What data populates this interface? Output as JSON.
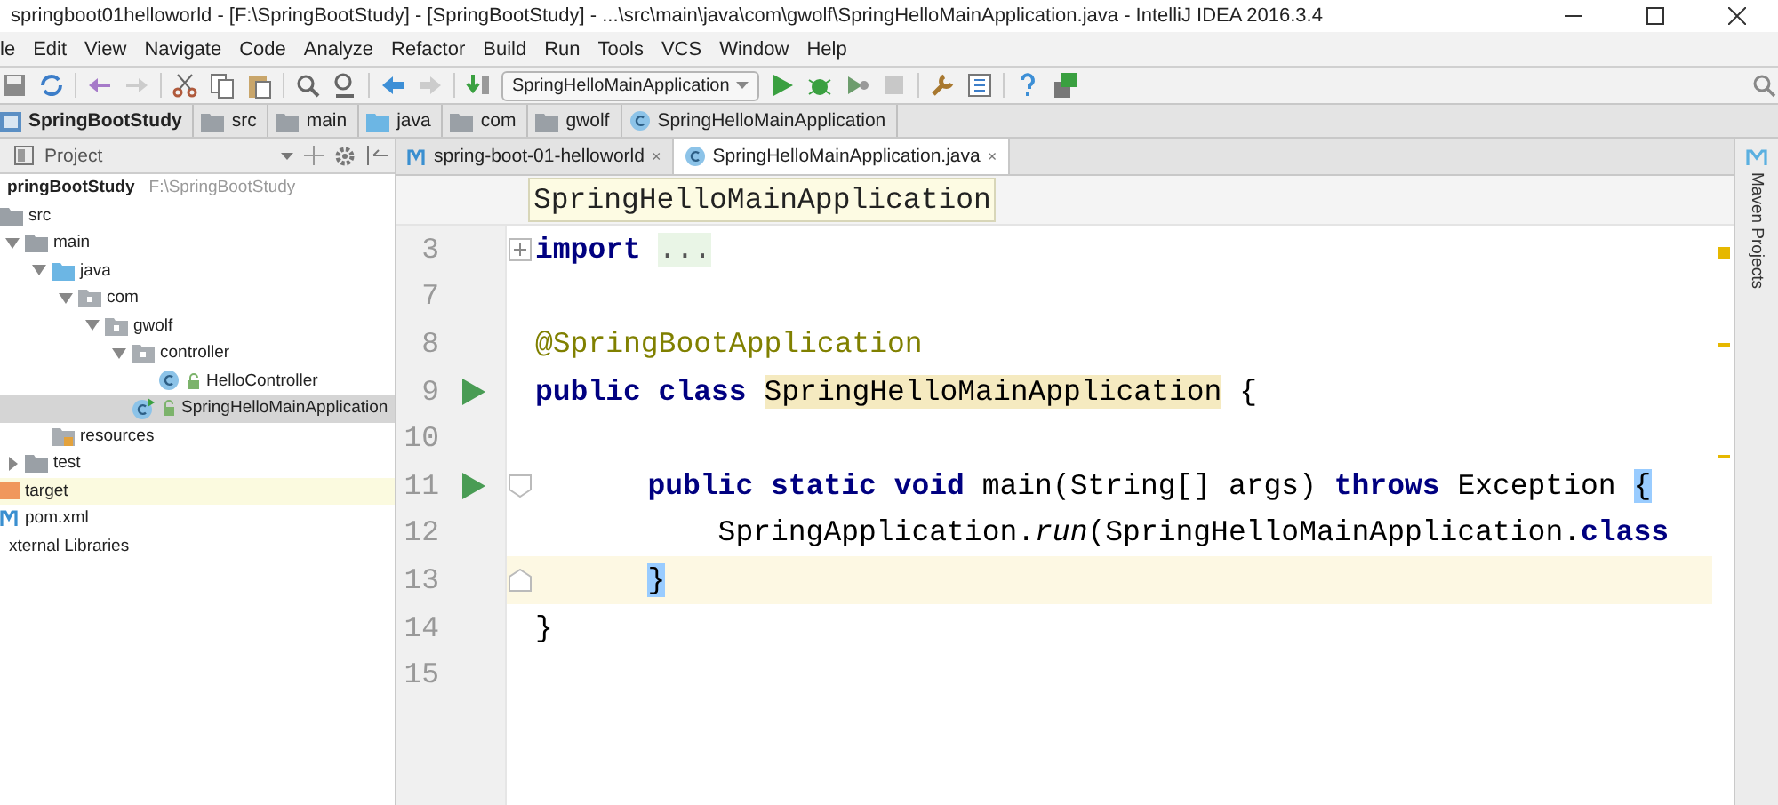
{
  "window": {
    "title": "springboot01helloworld - [F:\\SpringBootStudy] - [SpringBootStudy] - ...\\src\\main\\java\\com\\gwolf\\SpringHelloMainApplication.java - IntelliJ IDEA 2016.3.4"
  },
  "menu": [
    "le",
    "Edit",
    "View",
    "Navigate",
    "Code",
    "Analyze",
    "Refactor",
    "Build",
    "Run",
    "Tools",
    "VCS",
    "Window",
    "Help"
  ],
  "toolbar": {
    "run_config": "SpringHelloMainApplication"
  },
  "breadcrumbs": [
    {
      "label": "SpringBootStudy",
      "kind": "module"
    },
    {
      "label": "src",
      "kind": "folder"
    },
    {
      "label": "main",
      "kind": "folder"
    },
    {
      "label": "java",
      "kind": "source"
    },
    {
      "label": "com",
      "kind": "folder"
    },
    {
      "label": "gwolf",
      "kind": "folder"
    },
    {
      "label": "SpringHelloMainApplication",
      "kind": "class"
    }
  ],
  "project_panel": {
    "title": "Project",
    "tree": [
      {
        "label": "pringBootStudy",
        "path": "F:\\SpringBootStudy",
        "kind": "module",
        "selected": false,
        "children": [
          {
            "label": "src",
            "kind": "folder",
            "selected": false,
            "children": [
              {
                "label": "main",
                "kind": "folder",
                "expanded": true,
                "selected": false,
                "children": [
                  {
                    "label": "java",
                    "kind": "source",
                    "expanded": true,
                    "selected": false,
                    "children": [
                      {
                        "label": "com",
                        "kind": "package",
                        "expanded": true,
                        "selected": false,
                        "children": [
                          {
                            "label": "gwolf",
                            "kind": "package",
                            "expanded": true,
                            "selected": false,
                            "children": [
                              {
                                "label": "controller",
                                "kind": "package",
                                "expanded": true,
                                "selected": false,
                                "children": [
                                  {
                                    "label": "HelloController",
                                    "kind": "class",
                                    "selected": false
                                  }
                                ]
                              },
                              {
                                "label": "SpringHelloMainApplication",
                                "kind": "main-class",
                                "selected": true
                              }
                            ]
                          }
                        ]
                      }
                    ]
                  },
                  {
                    "label": "resources",
                    "kind": "resources",
                    "selected": false
                  }
                ]
              },
              {
                "label": "test",
                "kind": "folder",
                "expanded": false,
                "selected": false
              }
            ]
          },
          {
            "label": "target",
            "kind": "excluded",
            "selected": false
          },
          {
            "label": "pom.xml",
            "kind": "maven",
            "selected": false
          }
        ]
      },
      {
        "label": "xternal Libraries",
        "kind": "library",
        "selected": false
      }
    ]
  },
  "editor_tabs": [
    {
      "label": "spring-boot-01-helloworld",
      "kind": "maven",
      "selected": false,
      "close": "×"
    },
    {
      "label": "SpringHelloMainApplication.java",
      "kind": "class",
      "selected": true,
      "close": "×"
    }
  ],
  "hint": "SpringHelloMainApplication",
  "code_lines": [
    {
      "number": "3",
      "runnable": false,
      "fold": {
        "kind": "collapsed"
      },
      "current": false,
      "tokens": [
        {
          "text": "import ",
          "kind": "keyword"
        },
        {
          "text": "...",
          "kind": "folded"
        }
      ]
    },
    {
      "number": "7",
      "runnable": false,
      "current": false
    },
    {
      "number": "8",
      "runnable": false,
      "current": false,
      "tokens": [
        {
          "text": "@SpringBootApplication",
          "kind": "annotation"
        }
      ]
    },
    {
      "number": "9",
      "runnable": true,
      "current": false,
      "tokens": [
        {
          "text": "public class ",
          "kind": "keyword"
        },
        {
          "text": "SpringHelloMainApplication",
          "kind": "usage"
        },
        {
          "text": " {",
          "kind": "plain"
        }
      ]
    },
    {
      "number": "10",
      "runnable": false,
      "current": false
    },
    {
      "number": "11",
      "runnable": true,
      "fold": {
        "kind": "start"
      },
      "indent": {
        "kind": "method"
      },
      "current": false,
      "tokens": [
        {
          "text": "public static void",
          "kind": "keyword"
        },
        {
          "text": " main(String[] args) ",
          "kind": "plain"
        },
        {
          "text": "throws",
          "kind": "keyword"
        },
        {
          "text": " Exception ",
          "kind": "plain"
        },
        {
          "text": "{",
          "kind": "brace"
        }
      ]
    },
    {
      "number": "12",
      "runnable": false,
      "indent": {
        "kind": "statement"
      },
      "current": false,
      "tokens": [
        {
          "text": "SpringApplication.",
          "kind": "plain"
        },
        {
          "text": "run",
          "kind": "italic"
        },
        {
          "text": "(SpringHelloMainApplication.",
          "kind": "plain"
        },
        {
          "text": "class",
          "kind": "keyword"
        }
      ]
    },
    {
      "number": "13",
      "runnable": false,
      "fold": {
        "kind": "end"
      },
      "indent": {
        "kind": "method"
      },
      "current": true,
      "tokens": [
        {
          "text": "}",
          "kind": "brace"
        }
      ]
    },
    {
      "number": "14",
      "runnable": false,
      "current": false,
      "tokens": [
        {
          "text": "}",
          "kind": "plain"
        }
      ]
    },
    {
      "number": "15",
      "runnable": false,
      "current": false
    }
  ],
  "side_tool": {
    "label": "Maven Projects"
  }
}
